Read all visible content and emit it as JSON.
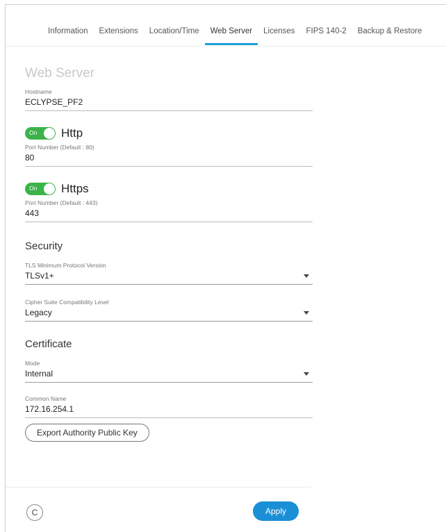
{
  "tabs": [
    {
      "label": "Information"
    },
    {
      "label": "Extensions"
    },
    {
      "label": "Location/Time"
    },
    {
      "label": "Web Server",
      "active": true
    },
    {
      "label": "Licenses"
    },
    {
      "label": "FIPS 140-2"
    },
    {
      "label": "Backup & Restore"
    }
  ],
  "web_server": {
    "title": "Web Server",
    "hostname": {
      "label": "Hostname",
      "value": "ECLYPSE_PF2"
    },
    "http": {
      "toggle_text": "On",
      "label": "Http",
      "port_label": "Port Number (Default : 80)",
      "port_value": "80"
    },
    "https": {
      "toggle_text": "On",
      "label": "Https",
      "port_label": "Port Number (Default : 443)",
      "port_value": "443"
    }
  },
  "security": {
    "title": "Security",
    "tls": {
      "label": "TLS Minimum Protocol Version",
      "value": "TLSv1+"
    },
    "cipher": {
      "label": "Cipher Suite Compatibility Level",
      "value": "Legacy"
    }
  },
  "certificate": {
    "title": "Certificate",
    "mode": {
      "label": "Mode",
      "value": "Internal"
    },
    "common_name": {
      "label": "Common Name",
      "value": "172.16.254.1"
    },
    "export_button": "Export Authority Public Key"
  },
  "footer": {
    "refresh_icon": "C",
    "apply_label": "Apply"
  },
  "colors": {
    "accent": "#1aa0d8",
    "toggle_on": "#3cb34a",
    "apply": "#1a8fd6"
  }
}
